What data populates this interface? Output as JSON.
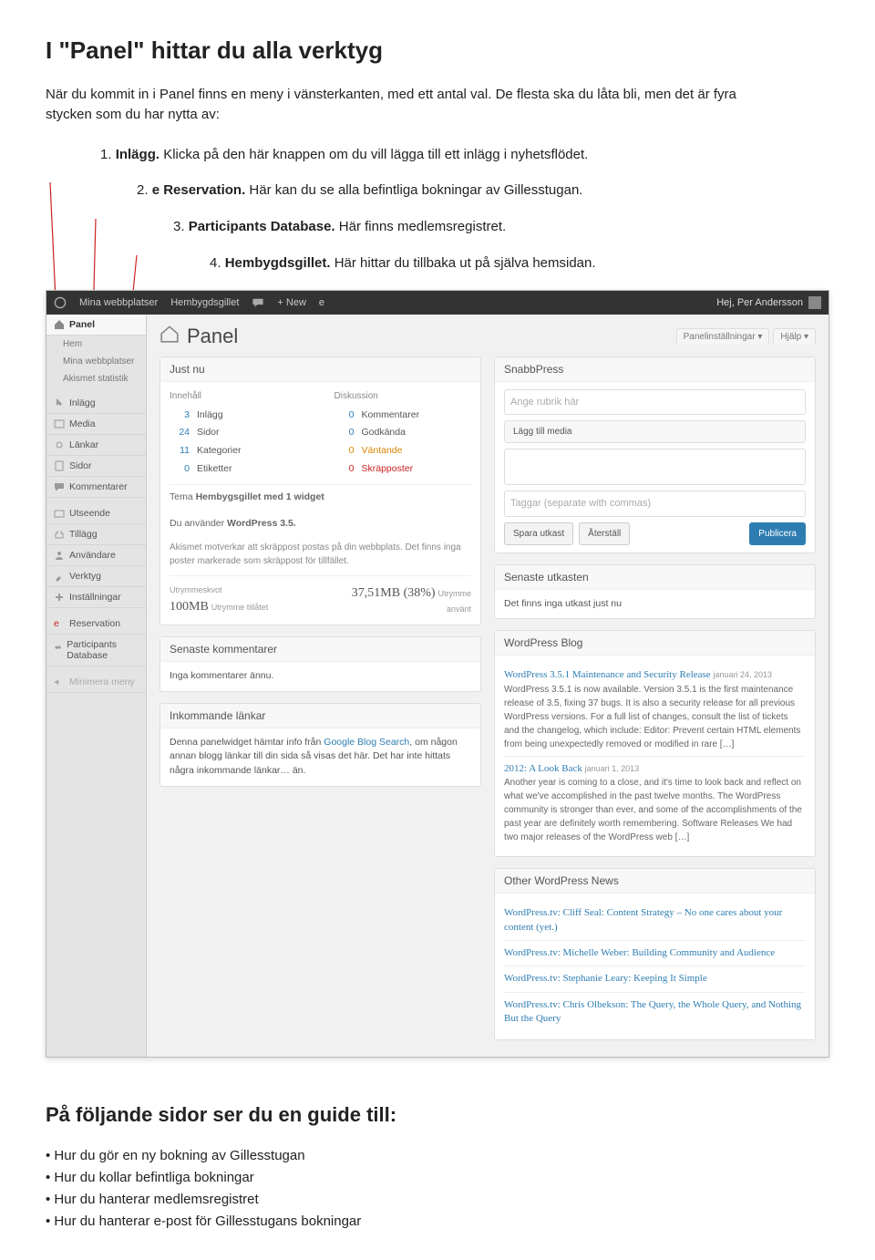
{
  "doc": {
    "title": "I \"Panel\" hittar du alla verktyg",
    "intro": "När du kommit in i Panel finns en meny i vänsterkanten, med ett antal val. De flesta ska du låta bli, men det är fyra stycken som du har nytta av:",
    "items": [
      {
        "num": "1.",
        "label": "Inlägg.",
        "text": " Klicka på den här knappen om du vill lägga till ett inlägg i nyhetsflödet."
      },
      {
        "num": "2.",
        "label": "e Reservation.",
        "text": " Här kan du se alla befintliga bokningar av Gillesstugan."
      },
      {
        "num": "3.",
        "label": "Participants Database.",
        "text": " Här finns medlemsregistret."
      },
      {
        "num": "4.",
        "label": "Hembygdsgillet.",
        "text": " Här hittar du tillbaka ut på själva hemsidan."
      }
    ],
    "footer_title": "På följande sidor ser du en guide till:",
    "bullets": [
      "Hur du gör en ny bokning av Gillesstugan",
      "Hur du kollar befintliga bokningar",
      "Hur du hanterar medlemsregistret",
      "Hur du hanterar e-post för Gillesstugans bokningar"
    ]
  },
  "wp": {
    "topbar": {
      "mysites": "Mina webbplatser",
      "sitename": "Hembygdsgillet",
      "new": "+ New",
      "e": "e",
      "greeting": "Hej, Per Andersson"
    },
    "sidebar": {
      "panel": "Panel",
      "hem": "Hem",
      "mina_webbplatser": "Mina webbplatser",
      "akismet_stat": "Akismet statistik",
      "inlagg": "Inlägg",
      "media": "Media",
      "lankar": "Länkar",
      "sidor": "Sidor",
      "kommentarer": "Kommentarer",
      "utseende": "Utseende",
      "tillagg": "Tillägg",
      "anvandare": "Användare",
      "verktyg": "Verktyg",
      "installningar": "Inställningar",
      "reservation": "Reservation",
      "participants": "Participants Database",
      "minimize": "Minimera meny"
    },
    "panel_title": "Panel",
    "tabs": {
      "settings": "Panelinställningar",
      "help": "Hjälp"
    },
    "justnu": {
      "title": "Just nu",
      "col1_label": "Innehåll",
      "col2_label": "Diskussion",
      "rows1": [
        {
          "n": "3",
          "t": "Inlägg"
        },
        {
          "n": "24",
          "t": "Sidor"
        },
        {
          "n": "11",
          "t": "Kategorier"
        },
        {
          "n": "0",
          "t": "Etiketter"
        }
      ],
      "rows2": [
        {
          "n": "0",
          "t": "Kommentarer"
        },
        {
          "n": "0",
          "t": "Godkända"
        },
        {
          "n": "0",
          "t": "Väntande",
          "orange": true
        },
        {
          "n": "0",
          "t": "Skräpposter",
          "red": true
        }
      ],
      "theme_line_pre": "Tema ",
      "theme_line_bold": "Hembygsgillet med 1 widget",
      "wp_version_pre": "Du använder ",
      "wp_version_bold": "WordPress 3.5.",
      "akismet": "Akismet motverkar att skräppost postas på din webbplats. Det finns inga poster markerade som skräppost för tillfället.",
      "storage_label": "Utrymmeskvot",
      "storage_total": "100MB",
      "storage_total_sub": "Utrymme tillåtet",
      "storage_used": "37,51MB (38%)",
      "storage_used_sub": "Utrymme använt"
    },
    "senkomm": {
      "title": "Senaste kommentarer",
      "text": "Inga kommentarer ännu."
    },
    "inlankar": {
      "title": "Inkommande länkar",
      "text_pre": "Denna panelwidget hämtar info från ",
      "link": "Google Blog Search",
      "text_post": ", om någon annan blogg länkar till din sida så visas det här. Det har inte hittats några inkommande länkar… än."
    },
    "snabb": {
      "title": "SnabbPress",
      "ph_title": "Ange rubrik här",
      "media_btn": "Lägg till media",
      "tags_ph": "Taggar (separate with commas)",
      "save": "Spara utkast",
      "reset": "Återställ",
      "publish": "Publicera"
    },
    "utkast": {
      "title": "Senaste utkasten",
      "text": "Det finns inga utkast just nu"
    },
    "blog": {
      "title": "WordPress Blog",
      "items": [
        {
          "title": "WordPress 3.5.1 Maintenance and Security Release",
          "date": "januari 24, 2013",
          "text": "WordPress 3.5.1 is now available. Version 3.5.1 is the first maintenance release of 3.5, fixing 37 bugs. It is also a security release for all previous WordPress versions. For a full list of changes, consult the list of tickets and the changelog, which include: Editor: Prevent certain HTML elements from being unexpectedly removed or modified in rare […]"
        },
        {
          "title": "2012: A Look Back",
          "date": "januari 1, 2013",
          "text": "Another year is coming to a close, and it's time to look back and reflect on what we've accomplished in the past twelve months. The WordPress community is stronger than ever, and some of the accomplishments of the past year are definitely worth remembering. Software Releases We had two major releases of the WordPress web […]"
        }
      ]
    },
    "other": {
      "title": "Other WordPress News",
      "items": [
        "WordPress.tv: Cliff Seal: Content Strategy – No one cares about your content (yet.)",
        "WordPress.tv: Michelle Weber: Building Community and Audience",
        "WordPress.tv: Stephanie Leary: Keeping It Simple",
        "WordPress.tv: Chris Olbekson: The Query, the Whole Query, and Nothing But the Query"
      ]
    }
  }
}
